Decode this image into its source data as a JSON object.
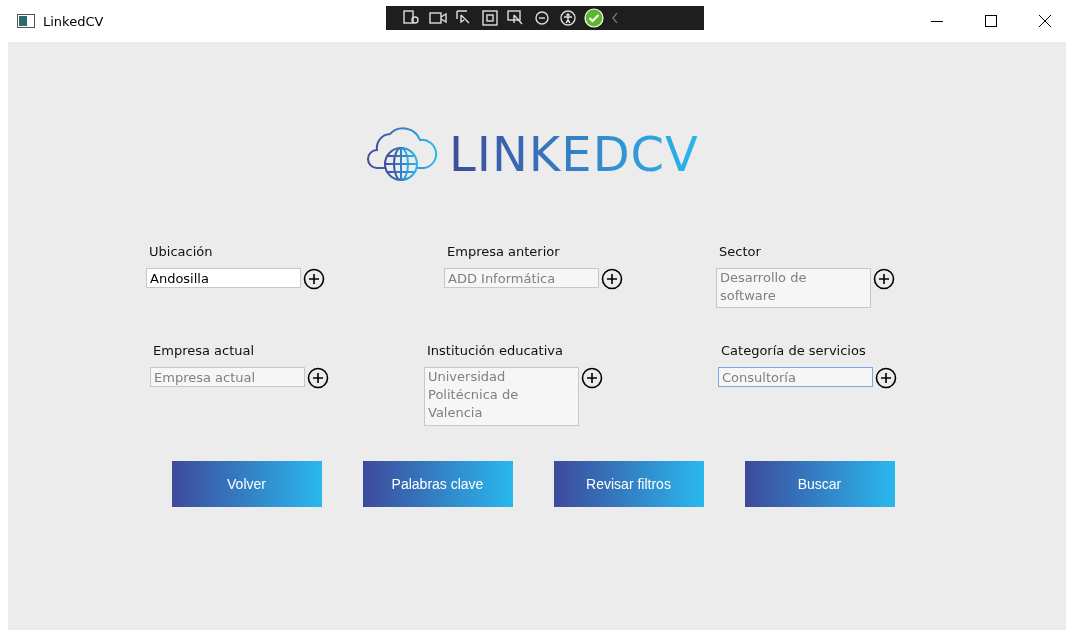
{
  "window": {
    "title": "LinkedCV"
  },
  "logo": {
    "text": "LINKEDCV"
  },
  "fields": [
    {
      "label": "Ubicación",
      "value": "Andosilla",
      "kind": "single",
      "focused": false
    },
    {
      "label": "Empresa anterior",
      "placeholder": "ADD Informática",
      "kind": "single",
      "focused": false
    },
    {
      "label": "Sector",
      "placeholder": "Desarrollo de software",
      "kind": "multi",
      "focused": false
    },
    {
      "label": "Empresa actual",
      "placeholder": "Empresa actual",
      "kind": "single",
      "focused": false
    },
    {
      "label": "Institución educativa",
      "placeholder": "Universidad Politécnica de Valencia",
      "kind": "multi",
      "focused": false
    },
    {
      "label": "Categoría de servicios",
      "placeholder": "Consultoría",
      "kind": "single",
      "focused": true
    }
  ],
  "buttons": [
    "Volver",
    "Palabras clave",
    "Revisar filtros",
    "Buscar"
  ]
}
